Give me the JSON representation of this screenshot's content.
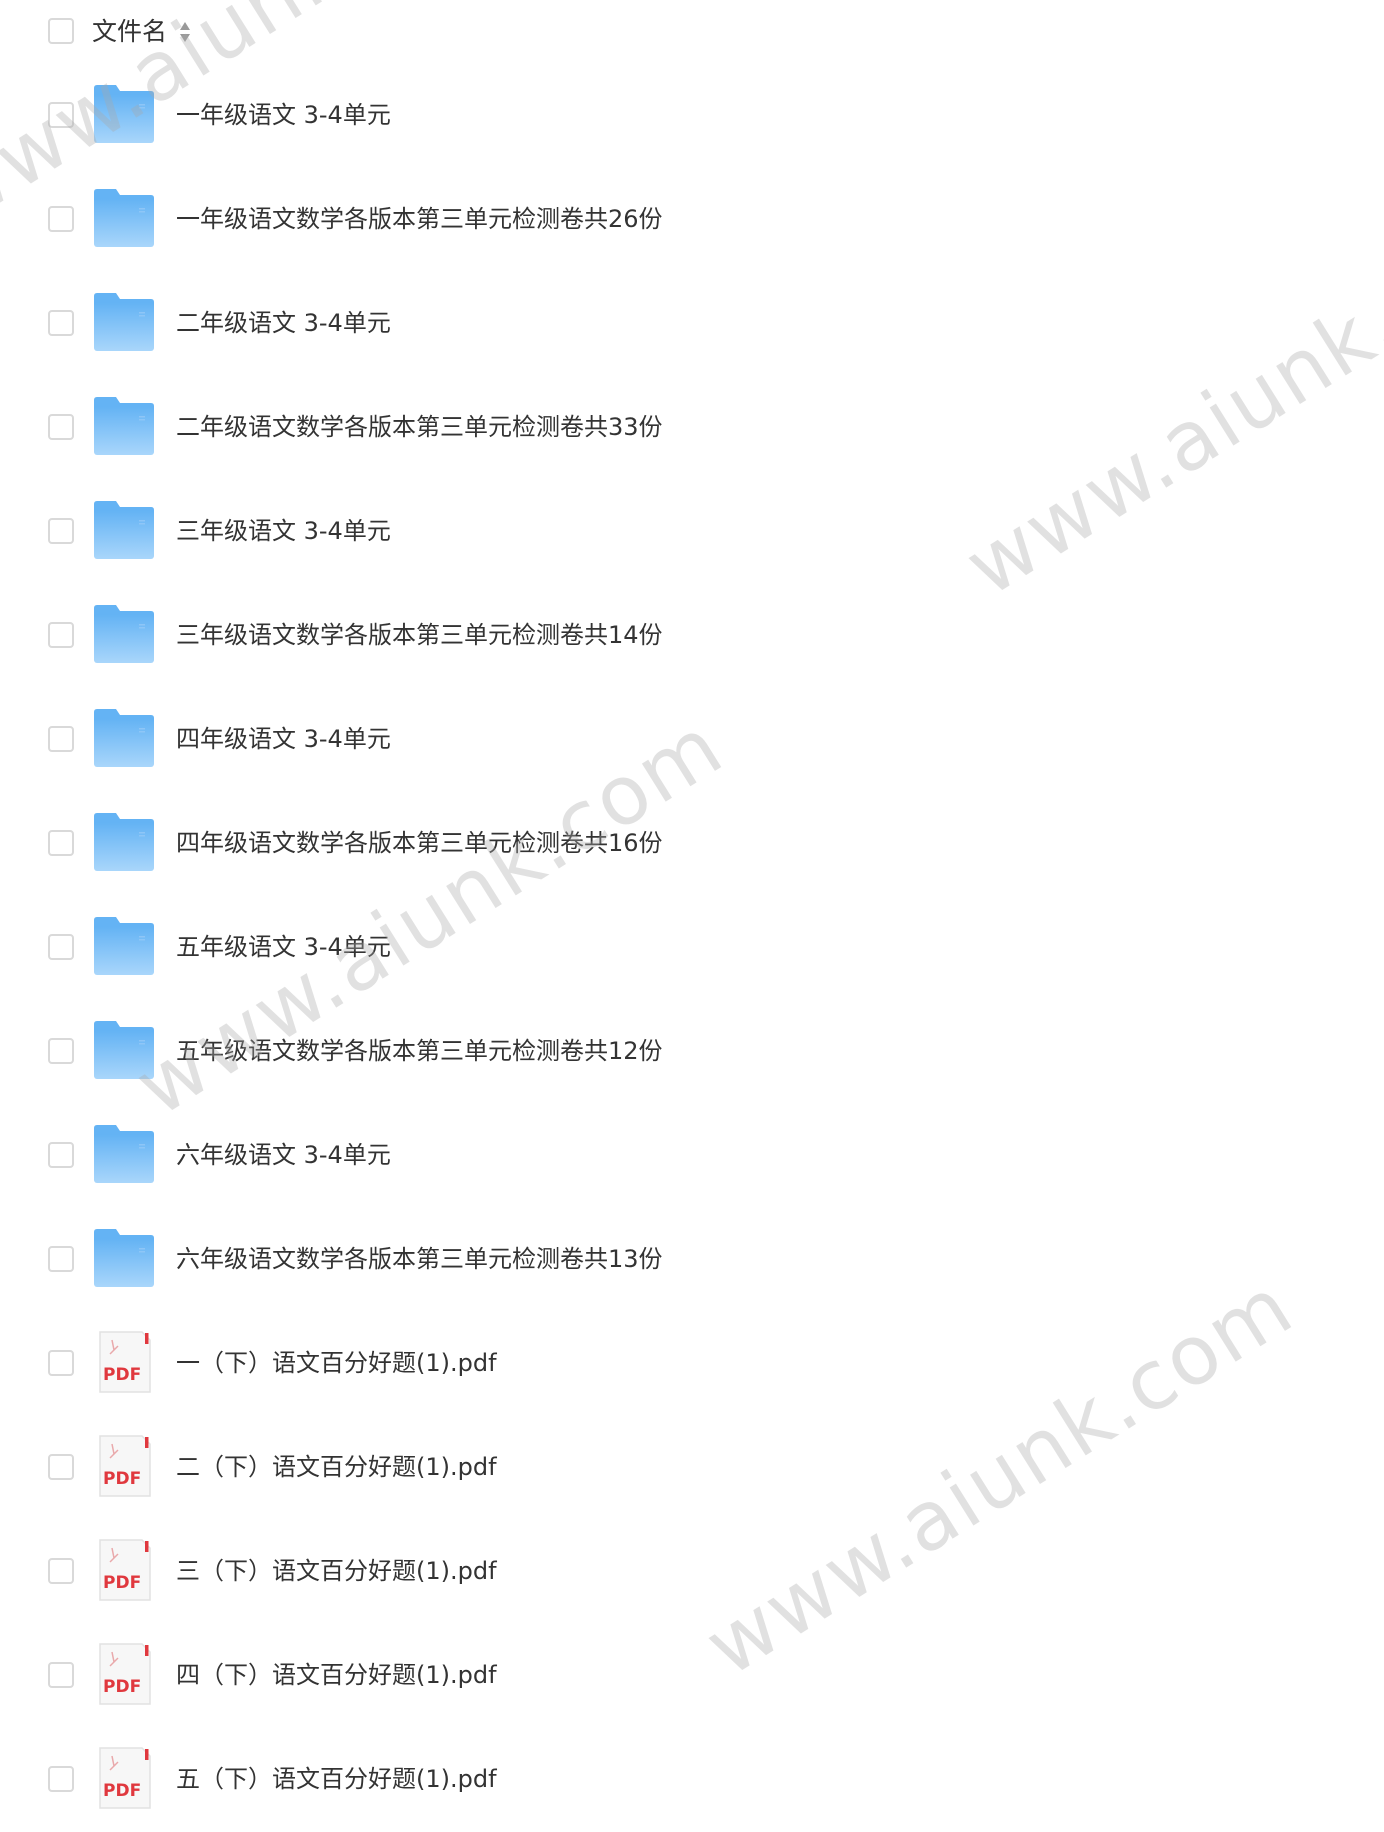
{
  "header": {
    "column_label": "文件名",
    "sort_icon": "sort-icon"
  },
  "files": [
    {
      "name": "一年级语文 3-4单元",
      "type": "folder"
    },
    {
      "name": "一年级语文数学各版本第三单元检测卷共26份",
      "type": "folder"
    },
    {
      "name": "二年级语文 3-4单元",
      "type": "folder"
    },
    {
      "name": "二年级语文数学各版本第三单元检测卷共33份",
      "type": "folder"
    },
    {
      "name": "三年级语文 3-4单元",
      "type": "folder"
    },
    {
      "name": "三年级语文数学各版本第三单元检测卷共14份",
      "type": "folder"
    },
    {
      "name": "四年级语文 3-4单元",
      "type": "folder"
    },
    {
      "name": "四年级语文数学各版本第三单元检测卷共16份",
      "type": "folder"
    },
    {
      "name": "五年级语文 3-4单元",
      "type": "folder"
    },
    {
      "name": "五年级语文数学各版本第三单元检测卷共12份",
      "type": "folder"
    },
    {
      "name": "六年级语文 3-4单元",
      "type": "folder"
    },
    {
      "name": "六年级语文数学各版本第三单元检测卷共13份",
      "type": "folder"
    },
    {
      "name": "一（下）语文百分好题(1).pdf",
      "type": "pdf"
    },
    {
      "name": "二（下）语文百分好题(1).pdf",
      "type": "pdf"
    },
    {
      "name": "三（下）语文百分好题(1).pdf",
      "type": "pdf"
    },
    {
      "name": "四（下）语文百分好题(1).pdf",
      "type": "pdf"
    },
    {
      "name": "五（下）语文百分好题(1).pdf",
      "type": "pdf"
    }
  ],
  "icons": {
    "folder": "folder-icon",
    "pdf": "pdf-file-icon",
    "pdf_badge": "PDF"
  },
  "watermarks": [
    "www.aiunk.com",
    "www.aiunk.com",
    "www.aiunk.com",
    "www.aiunk.com"
  ],
  "colors": {
    "folder_light": "#a9d6fb",
    "folder_dark": "#64b3f4",
    "pdf_red": "#e0383e",
    "text": "#333333",
    "checkbox_border": "#d9d9d9"
  }
}
